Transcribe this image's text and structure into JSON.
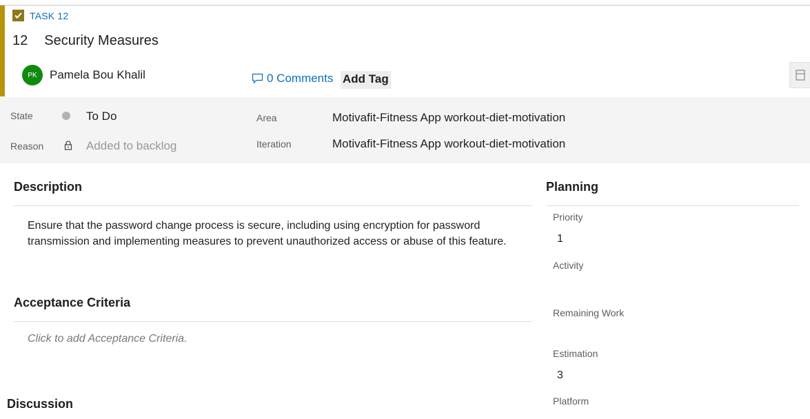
{
  "work_item": {
    "type_label": "TASK 12",
    "id": "12",
    "title": "Security Measures",
    "accent_color": "#b7950b"
  },
  "assignee": {
    "initials": "PK",
    "name": "Pamela Bou Khalil",
    "avatar_color": "#0f8a0f"
  },
  "toolbar": {
    "comments_label": "0 Comments",
    "add_tag_label": "Add Tag"
  },
  "fields": {
    "state_label": "State",
    "state_value": "To Do",
    "reason_label": "Reason",
    "reason_value": "Added to backlog",
    "area_label": "Area",
    "area_value": "Motivafit-Fitness App workout-diet-motivation",
    "iteration_label": "Iteration",
    "iteration_value": "Motivafit-Fitness App workout-diet-motivation"
  },
  "description": {
    "heading": "Description",
    "text": "Ensure that the password change process is secure, including using encryption for password transmission and implementing measures to prevent unauthorized access or abuse of this feature."
  },
  "acceptance_criteria": {
    "heading": "Acceptance Criteria",
    "placeholder": "Click to add Acceptance Criteria."
  },
  "discussion": {
    "heading": "Discussion"
  },
  "planning": {
    "heading": "Planning",
    "priority_label": "Priority",
    "priority_value": "1",
    "activity_label": "Activity",
    "activity_value": "",
    "remaining_work_label": "Remaining Work",
    "remaining_work_value": "",
    "estimation_label": "Estimation",
    "estimation_value": "3",
    "platform_label": "Platform"
  }
}
